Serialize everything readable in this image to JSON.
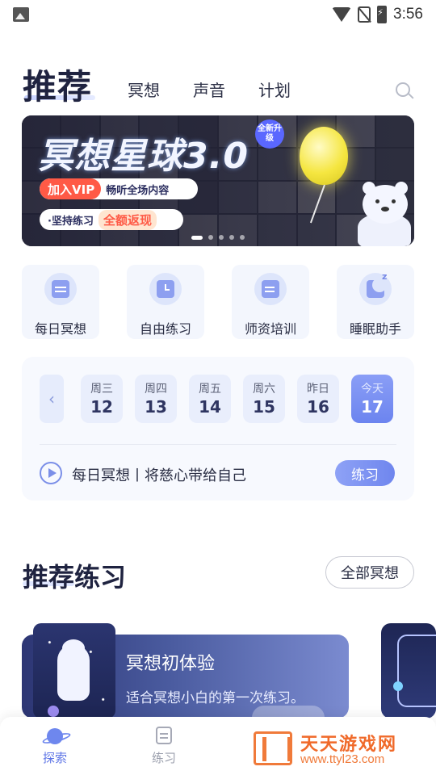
{
  "status_bar": {
    "time": "3:56",
    "icons": [
      "image-icon",
      "wifi-icon",
      "no-sim-icon",
      "battery-charging-icon"
    ]
  },
  "header": {
    "title": "推荐",
    "tabs": [
      {
        "label": "冥想"
      },
      {
        "label": "声音"
      },
      {
        "label": "计划"
      }
    ],
    "search_icon": "search-icon"
  },
  "banner": {
    "title": "冥想星球3.0",
    "badge": "全新升级",
    "vip_label": "加入VIP",
    "vip_desc": "畅听全场内容",
    "persist_label": "·坚持练习",
    "persist_highlight": "全额返现",
    "page_count": 5,
    "active_page": 1
  },
  "quick_entries": [
    {
      "label": "每日冥想",
      "icon": "calendar-icon"
    },
    {
      "label": "自由练习",
      "icon": "clock-icon"
    },
    {
      "label": "师资培训",
      "icon": "document-icon"
    },
    {
      "label": "睡眠助手",
      "icon": "moon-icon"
    }
  ],
  "daily": {
    "days": [
      {
        "name": "周三",
        "num": "12"
      },
      {
        "name": "周四",
        "num": "13"
      },
      {
        "name": "周五",
        "num": "14"
      },
      {
        "name": "周六",
        "num": "15"
      },
      {
        "name": "昨日",
        "num": "16"
      },
      {
        "name": "今天",
        "num": "17"
      }
    ],
    "selected_index": 5,
    "text": "每日冥想丨将慈心带给自己",
    "button": "练习"
  },
  "recommend": {
    "title": "推荐练习",
    "all_button": "全部冥想",
    "card": {
      "title": "冥想初体验",
      "subtitle": "适合冥想小白的第一次练习。"
    }
  },
  "bottom_nav": [
    {
      "label": "探索",
      "icon": "planet-icon",
      "active": true
    },
    {
      "label": "练习",
      "icon": "edit-icon",
      "active": false
    }
  ],
  "watermark": {
    "title": "天天游戏网",
    "url": "www.ttyl23.com"
  },
  "colors": {
    "accent": "#6e87ee",
    "text": "#2b2f45",
    "vip_red": "#ff5a46"
  }
}
